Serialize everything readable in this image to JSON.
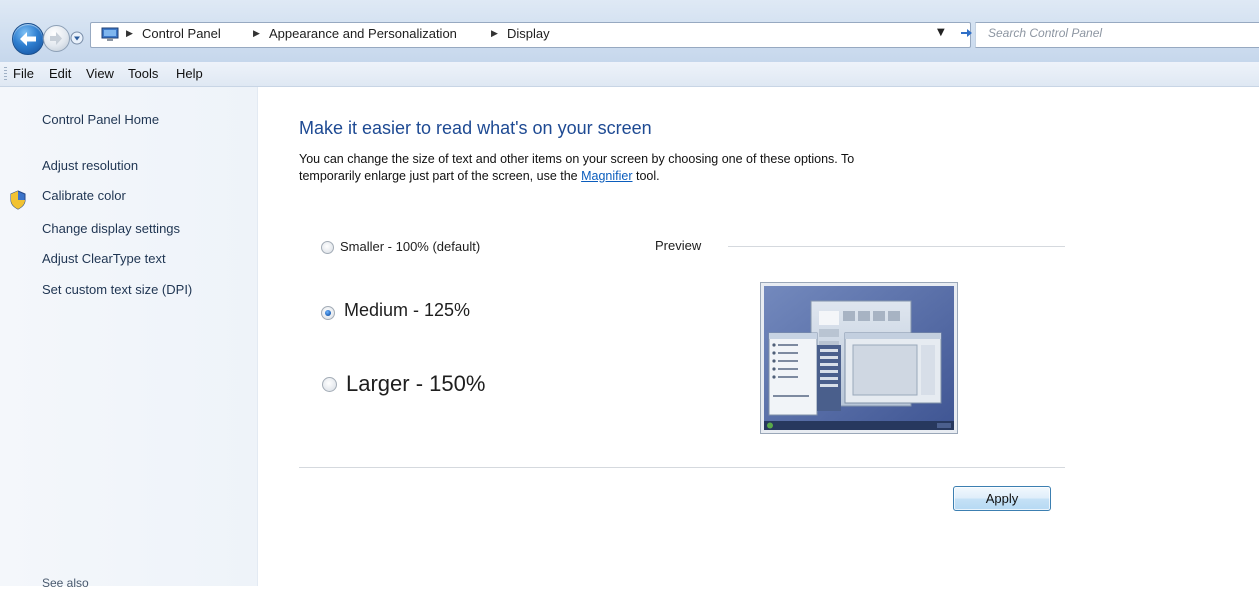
{
  "nav": {
    "breadcrumbs": [
      "Control Panel",
      "Appearance and Personalization",
      "Display"
    ],
    "search_placeholder": "Search Control Panel"
  },
  "menu": {
    "items": [
      "File",
      "Edit",
      "View",
      "Tools",
      "Help"
    ]
  },
  "sidebar": {
    "home": "Control Panel Home",
    "links": [
      "Adjust resolution",
      "Calibrate color",
      "Change display settings",
      "Adjust ClearType text",
      "Set custom text size (DPI)"
    ],
    "see_also": "See also"
  },
  "main": {
    "title": "Make it easier to read what's on your screen",
    "desc_line1": "You can change the size of text and other items on your screen by choosing one of these options. To",
    "desc_line2_pre": "temporarily enlarge just part of the screen, use the ",
    "desc_link": "Magnifier",
    "desc_line2_post": " tool.",
    "options": [
      {
        "label": "Smaller - 100% (default)",
        "selected": false
      },
      {
        "label": "Medium - 125%",
        "selected": true
      },
      {
        "label": "Larger - 150%",
        "selected": false
      }
    ],
    "preview_label": "Preview",
    "apply_label": "Apply"
  },
  "colors": {
    "accent_title": "#1e4a93",
    "link": "#0b5dbd",
    "addressbar_bg": "#d3e1f1",
    "sidebar_bg": "#eef3f9",
    "preview_desktop": "#5a6ea5"
  },
  "icons": [
    "back-arrow-icon",
    "forward-arrow-icon",
    "history-dropdown-icon",
    "control-panel-icon",
    "refresh-icon",
    "uac-shield-icon",
    "display-preview-image"
  ]
}
